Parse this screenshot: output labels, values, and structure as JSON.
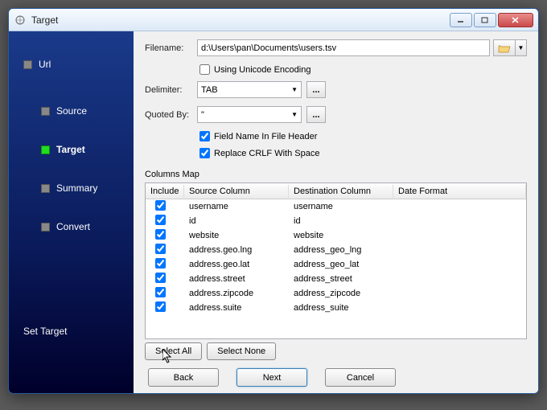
{
  "window": {
    "title": "Target"
  },
  "sidebar": {
    "items": [
      {
        "label": "Url"
      },
      {
        "label": "Source"
      },
      {
        "label": "Target"
      },
      {
        "label": "Summary"
      },
      {
        "label": "Convert"
      }
    ],
    "footer": "Set Target"
  },
  "form": {
    "filename_label": "Filename:",
    "filename_value": "d:\\Users\\pan\\Documents\\users.tsv",
    "unicode_label": "Using Unicode Encoding",
    "unicode_checked": false,
    "delimiter_label": "Delimiter:",
    "delimiter_value": "TAB",
    "quoted_label": "Quoted By:",
    "quoted_value": "\"",
    "fieldname_label": "Field Name In File Header",
    "fieldname_checked": true,
    "replace_crlf_label": "Replace CRLF With Space",
    "replace_crlf_checked": true,
    "ellipsis": "..."
  },
  "columns_map": {
    "label": "Columns Map",
    "headers": {
      "include": "Include",
      "source": "Source Column",
      "destination": "Destination Column",
      "date_format": "Date Format"
    },
    "rows": [
      {
        "checked": true,
        "source": "username",
        "destination": "username"
      },
      {
        "checked": true,
        "source": "id",
        "destination": "id"
      },
      {
        "checked": true,
        "source": "website",
        "destination": "website"
      },
      {
        "checked": true,
        "source": "address.geo.lng",
        "destination": "address_geo_lng"
      },
      {
        "checked": true,
        "source": "address.geo.lat",
        "destination": "address_geo_lat"
      },
      {
        "checked": true,
        "source": "address.street",
        "destination": "address_street"
      },
      {
        "checked": true,
        "source": "address.zipcode",
        "destination": "address_zipcode"
      },
      {
        "checked": true,
        "source": "address.suite",
        "destination": "address_suite"
      }
    ]
  },
  "buttons": {
    "select_all": "Select All",
    "select_none": "Select None",
    "back": "Back",
    "next": "Next",
    "cancel": "Cancel"
  }
}
